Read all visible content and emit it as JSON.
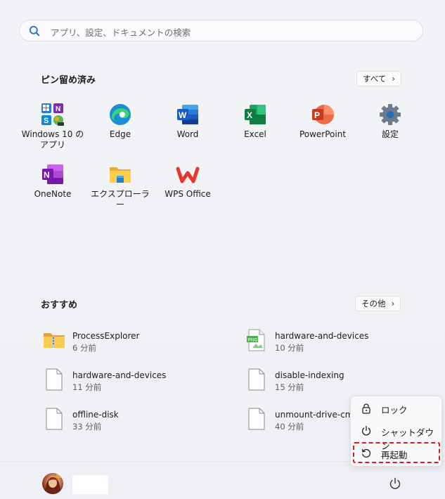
{
  "search": {
    "placeholder": "アプリ、設定、ドキュメントの検索",
    "icon": "search-icon"
  },
  "pinned": {
    "title": "ピン留め済み",
    "all_button": "すべて",
    "apps": [
      {
        "label": "Windows 10 のアプリ",
        "icon": "windows10-apps-icon"
      },
      {
        "label": "Edge",
        "icon": "edge-icon"
      },
      {
        "label": "Word",
        "icon": "word-icon"
      },
      {
        "label": "Excel",
        "icon": "excel-icon"
      },
      {
        "label": "PowerPoint",
        "icon": "powerpoint-icon"
      },
      {
        "label": "設定",
        "icon": "settings-gear-icon"
      },
      {
        "label": "OneNote",
        "icon": "onenote-icon"
      },
      {
        "label": "エクスプローラー",
        "icon": "folder-icon"
      },
      {
        "label": "WPS Office",
        "icon": "wps-office-icon"
      }
    ]
  },
  "recommended": {
    "title": "おすすめ",
    "more_button": "その他",
    "items": [
      {
        "name": "ProcessExplorer",
        "time": "6 分前",
        "icon": "zip-folder-icon"
      },
      {
        "name": "hardware-and-devices",
        "time": "10 分前",
        "icon": "png-file-icon"
      },
      {
        "name": "hardware-and-devices",
        "time": "11 分前",
        "icon": "file-icon"
      },
      {
        "name": "disable-indexing",
        "time": "15 分前",
        "icon": "file-icon"
      },
      {
        "name": "offline-disk",
        "time": "33 分前",
        "icon": "file-icon"
      },
      {
        "name": "unmount-drive-cmd",
        "time": "40 分前",
        "icon": "file-icon"
      }
    ]
  },
  "power_menu": {
    "items": [
      {
        "label": "ロック",
        "icon": "lock-icon"
      },
      {
        "label": "シャットダウン",
        "icon": "power-icon"
      },
      {
        "label": "再起動",
        "icon": "restart-icon"
      }
    ],
    "highlighted": "再起動",
    "highlight_color": "#e0191f"
  },
  "footer": {
    "user": "",
    "power_icon": "power-icon"
  }
}
